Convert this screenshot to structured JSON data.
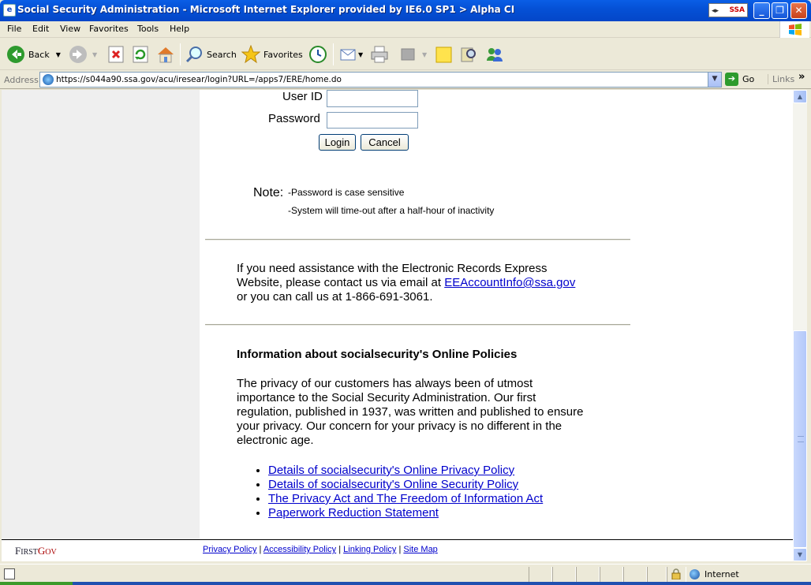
{
  "window": {
    "title": "Social Security Administration - Microsoft Internet Explorer provided by IE6.0 SP1  > Alpha CI",
    "logo_text": "SSA"
  },
  "menu": [
    "File",
    "Edit",
    "View",
    "Favorites",
    "Tools",
    "Help"
  ],
  "toolbar": {
    "back": "Back",
    "search": "Search",
    "favorites": "Favorites"
  },
  "address": {
    "label": "Address",
    "url": "https://s044a90.ssa.gov/acu/iresear/login?URL=/apps7/ERE/home.do",
    "go": "Go",
    "links": "Links"
  },
  "login": {
    "user_id_label": "User ID",
    "password_label": "Password",
    "login_button": "Login",
    "cancel_button": "Cancel"
  },
  "note": {
    "label": "Note:",
    "lines": [
      "-Password is case sensitive",
      "-System will time-out after a half-hour of inactivity"
    ]
  },
  "assistance": {
    "line1": "If you need assistance with the Electronic Records Express",
    "line2_prefix": "Website, please contact us via email at ",
    "email": "EEAccountInfo@ssa.gov",
    "line3": "or you can call us at 1-866-691-3061."
  },
  "policies": {
    "heading": "Information about socialsecurity's Online Policies",
    "body_lines": [
      "The privacy of our customers has always been of utmost",
      "importance to the Social Security Administration. Our first",
      "regulation, published in 1937, was written and published to ensure",
      "your privacy. Our concern for your privacy is no different in the",
      "electronic age."
    ],
    "links": [
      "Details of socialsecurity's Online Privacy Policy",
      "Details of socialsecurity's Online Security Policy",
      "The Privacy Act and The Freedom of Information Act",
      "Paperwork Reduction Statement"
    ]
  },
  "footer": {
    "logo_first": "F",
    "logo_rest1": "IRST",
    "logo_g": "G",
    "logo_rest2": "OV",
    "links": [
      "Privacy Policy",
      "Accessibility Policy",
      "Linking Policy",
      "Site Map"
    ],
    "separator": " | "
  },
  "status": {
    "zone": "Internet"
  },
  "colors": {
    "titlebar": "#0551d6",
    "link": "#0000cc",
    "left_column": "#efefef"
  }
}
